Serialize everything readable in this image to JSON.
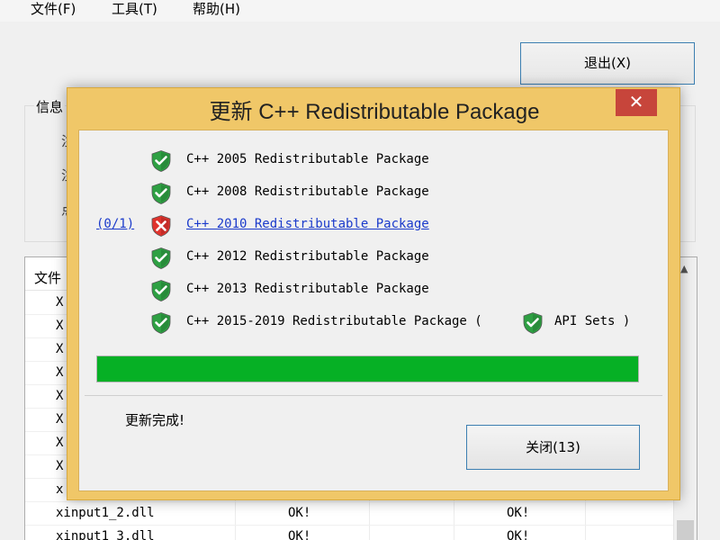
{
  "menubar": {
    "items": [
      "文件(F)",
      "工具(T)",
      "帮助(H)"
    ]
  },
  "main": {
    "exit_label": "退出(X)",
    "info_title": "信息",
    "side_fragments": [
      "注",
      "注",
      "点"
    ],
    "file_header": "文件",
    "rows": [
      {
        "name": "X",
        "s1": "",
        "s2": ""
      },
      {
        "name": "X",
        "s1": "",
        "s2": ""
      },
      {
        "name": "X",
        "s1": "",
        "s2": ""
      },
      {
        "name": "X",
        "s1": "",
        "s2": ""
      },
      {
        "name": "X",
        "s1": "",
        "s2": ""
      },
      {
        "name": "X",
        "s1": "",
        "s2": ""
      },
      {
        "name": "X",
        "s1": "",
        "s2": ""
      },
      {
        "name": "X",
        "s1": "",
        "s2": ""
      },
      {
        "name": "x",
        "s1": "",
        "s2": ""
      },
      {
        "name": "xinput1_2.dll",
        "s1": "OK!",
        "s2": "OK!"
      },
      {
        "name": "xinput1_3.dll",
        "s1": "OK!",
        "s2": "OK!"
      }
    ]
  },
  "dialog": {
    "title": "更新 C++ Redistributable Package",
    "close_glyph": "✕",
    "packages": [
      {
        "label": "C++ 2005 Redistributable Package",
        "status": "ok",
        "icon": "shield-check-icon"
      },
      {
        "label": "C++ 2008 Redistributable Package",
        "status": "ok",
        "icon": "shield-check-icon"
      },
      {
        "label": "C++ 2010 Redistributable Package",
        "status": "error",
        "icon": "shield-x-icon",
        "counter": "(0/1)"
      },
      {
        "label": "C++ 2012 Redistributable Package",
        "status": "ok",
        "icon": "shield-check-icon"
      },
      {
        "label": "C++ 2013 Redistributable Package",
        "status": "ok",
        "icon": "shield-check-icon"
      },
      {
        "label": "C++ 2015-2019 Redistributable Package (",
        "status": "ok",
        "icon": "shield-check-icon",
        "suffix_label": "API Sets )"
      }
    ],
    "progress_fraction": 1.0,
    "status_text": "更新完成!",
    "close_button_label": "关闭(13)"
  },
  "colors": {
    "ok": "#2ea043",
    "error": "#e0332d",
    "progress": "#06b025",
    "dialog_frame": "#f0c768",
    "link": "#1a3acb"
  }
}
